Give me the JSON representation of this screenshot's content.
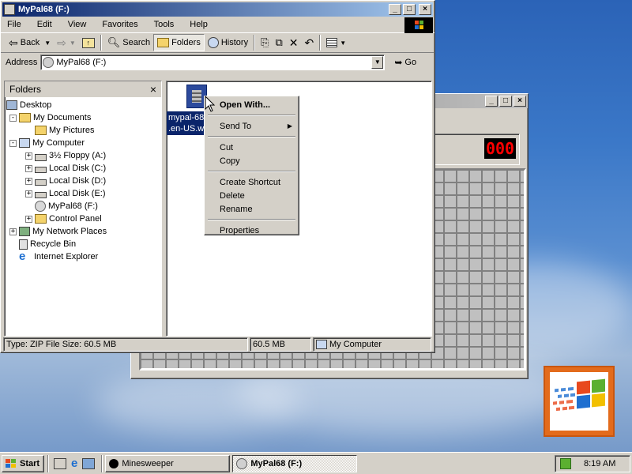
{
  "explorer": {
    "title": "MyPal68 (F:)",
    "menu": [
      "File",
      "Edit",
      "View",
      "Favorites",
      "Tools",
      "Help"
    ],
    "toolbar": {
      "back": "Back",
      "search": "Search",
      "folders": "Folders",
      "history": "History"
    },
    "address_label": "Address",
    "address_value": "MyPal68 (F:)",
    "go_label": "Go",
    "folders_pane": {
      "title": "Folders",
      "close": "×",
      "items": [
        {
          "label": "Desktop"
        },
        {
          "label": "My Documents",
          "toggle": "-"
        },
        {
          "label": "My Pictures"
        },
        {
          "label": "My Computer",
          "toggle": "-"
        },
        {
          "label": "3½ Floppy (A:)",
          "toggle": "+"
        },
        {
          "label": "Local Disk (C:)",
          "toggle": "+"
        },
        {
          "label": "Local Disk (D:)",
          "toggle": "+"
        },
        {
          "label": "Local Disk (E:)",
          "toggle": "+"
        },
        {
          "label": "MyPal68 (F:)"
        },
        {
          "label": "Control Panel",
          "toggle": "+"
        },
        {
          "label": "My Network Places",
          "toggle": "+"
        },
        {
          "label": "Recycle Bin"
        },
        {
          "label": "Internet Explorer"
        }
      ]
    },
    "file": {
      "name_line1": "mypal-68.",
      "name_line2": ".en-US.w"
    },
    "status": {
      "info": "Type: ZIP File Size: 60.5 MB",
      "size": "60.5 MB",
      "zone": "My Computer"
    }
  },
  "context_menu": {
    "items": [
      {
        "label": "Open With...",
        "bold": true
      },
      {
        "sep": true
      },
      {
        "label": "Send To",
        "submenu": true
      },
      {
        "sep": true
      },
      {
        "label": "Cut"
      },
      {
        "label": "Copy"
      },
      {
        "sep": true
      },
      {
        "label": "Create Shortcut"
      },
      {
        "label": "Delete"
      },
      {
        "label": "Rename"
      },
      {
        "sep": true
      },
      {
        "label": "Properties"
      }
    ]
  },
  "minesweeper": {
    "counter": "000"
  },
  "taskbar": {
    "start": "Start",
    "tasks": [
      {
        "label": "Minesweeper",
        "active": false
      },
      {
        "label": "MyPal68 (F:)",
        "active": true
      }
    ],
    "clock": "8:19 AM"
  },
  "colors": {
    "titlebar_active": "#0a246a",
    "titlebar_gradient_end": "#a6caf0",
    "selection": "#0a246a",
    "chrome": "#d4d0c8",
    "counter_digits": "#ff0000",
    "logo_frame": "#e36b1c"
  }
}
